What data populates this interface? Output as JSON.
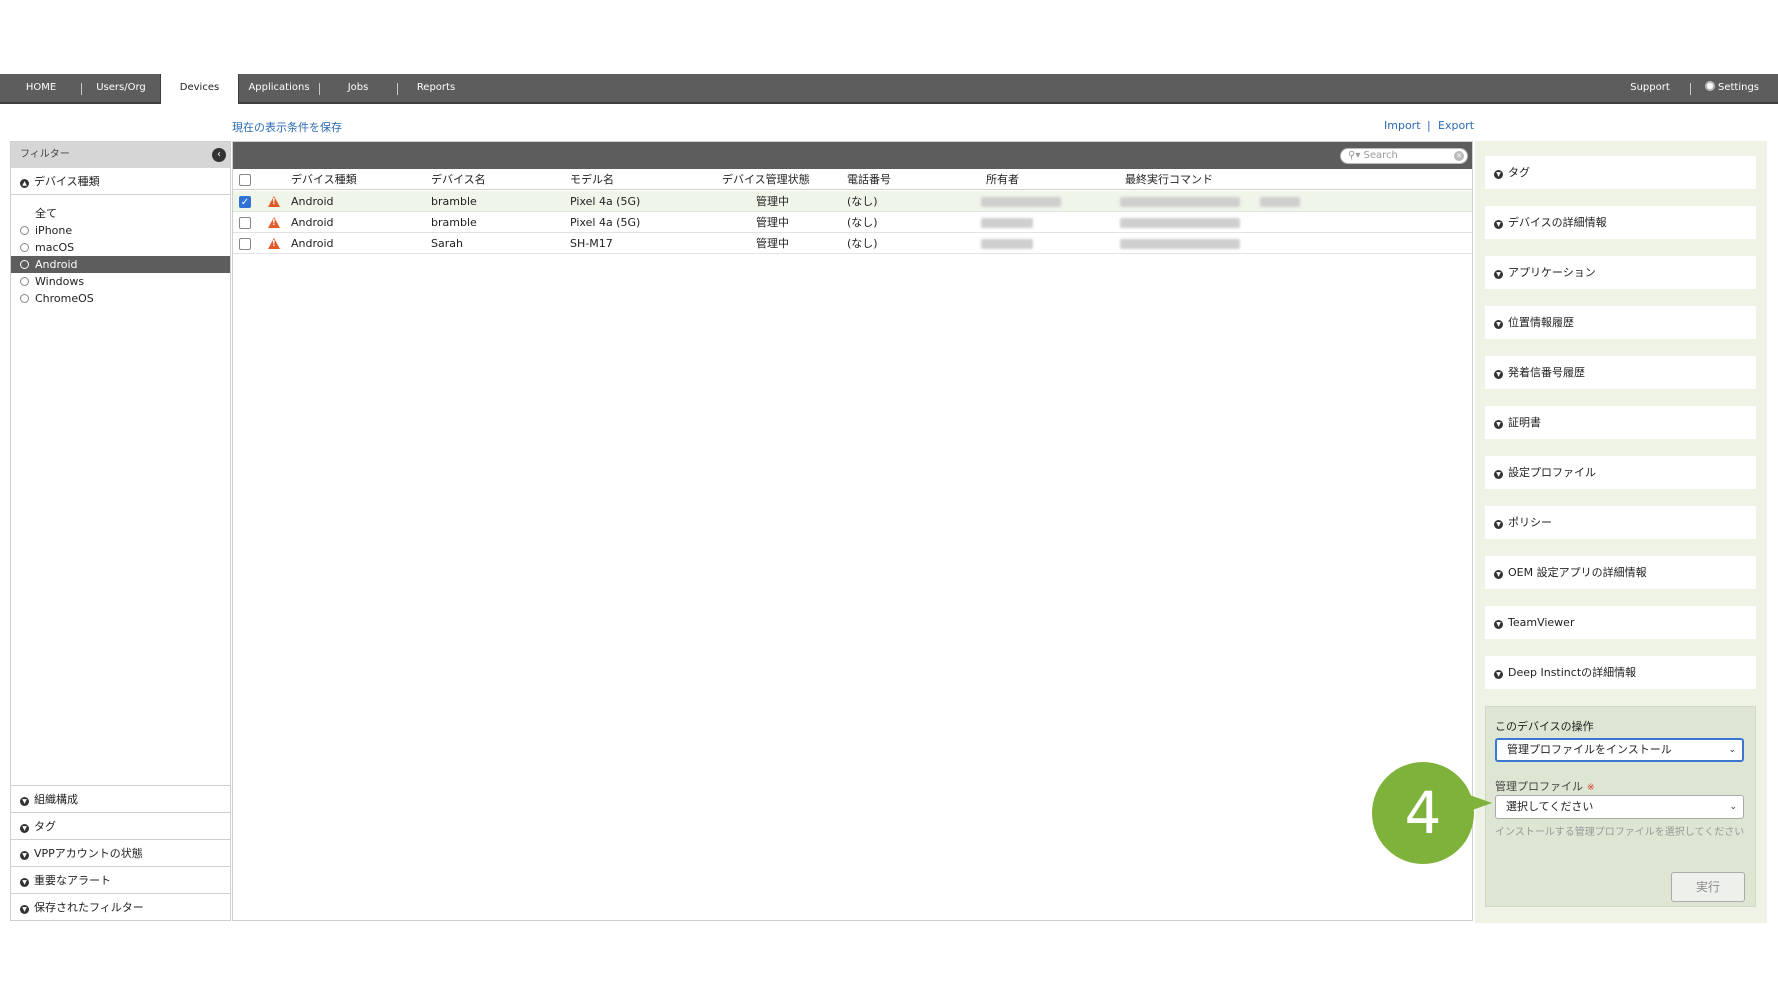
{
  "nav": {
    "tabs": [
      {
        "label": "HOME"
      },
      {
        "label": "Users/Org"
      },
      {
        "label": "Devices"
      },
      {
        "label": "Applications"
      },
      {
        "label": "Jobs"
      },
      {
        "label": "Reports"
      }
    ],
    "active_tab": "Devices",
    "support": "Support",
    "settings": "Settings"
  },
  "links": {
    "save_view": "現在の表示条件を保存",
    "import": "Import",
    "separator": "|",
    "export": "Export"
  },
  "filter": {
    "title": "フィルター",
    "device_type_header": "デバイス種類",
    "items": [
      {
        "label": "全て"
      },
      {
        "label": "iPhone"
      },
      {
        "label": "macOS"
      },
      {
        "label": "Android"
      },
      {
        "label": "Windows"
      },
      {
        "label": "ChromeOS"
      }
    ],
    "selected": "Android",
    "bottom_sections": [
      {
        "label": "組織構成"
      },
      {
        "label": "タグ"
      },
      {
        "label": "VPPアカウントの状態"
      },
      {
        "label": "重要なアラート"
      },
      {
        "label": "保存されたフィルター"
      }
    ]
  },
  "search": {
    "placeholder": "Search"
  },
  "table": {
    "columns": [
      "デバイス種類",
      "デバイス名",
      "モデル名",
      "デバイス管理状態",
      "電話番号",
      "所有者",
      "最終実行コマンド"
    ],
    "rows": [
      {
        "checked": true,
        "type": "Android",
        "name": "bramble",
        "model": "Pixel 4a (5G)",
        "status": "管理中",
        "phone": "(なし)"
      },
      {
        "checked": false,
        "type": "Android",
        "name": "bramble",
        "model": "Pixel 4a (5G)",
        "status": "管理中",
        "phone": "(なし)"
      },
      {
        "checked": false,
        "type": "Android",
        "name": "Sarah",
        "model": "SH-M17",
        "status": "管理中",
        "phone": "(なし)"
      }
    ]
  },
  "right_panel": {
    "sections": [
      {
        "label": "タグ"
      },
      {
        "label": "デバイスの詳細情報"
      },
      {
        "label": "アプリケーション"
      },
      {
        "label": "位置情報履歴"
      },
      {
        "label": "発着信番号履歴"
      },
      {
        "label": "証明書"
      },
      {
        "label": "設定プロファイル"
      },
      {
        "label": "ポリシー"
      },
      {
        "label": "OEM 設定アプリの詳細情報"
      },
      {
        "label": "TeamViewer"
      },
      {
        "label": "Deep Instinctの詳細情報"
      }
    ],
    "ops": {
      "title": "このデバイスの操作",
      "action_value": "管理プロファイルをインストール",
      "profile_label": "管理プロファイル",
      "required_mark": "※",
      "profile_value": "選択してください",
      "help": "インストールする管理プロファイルを選択してください",
      "run_label": "実行"
    }
  },
  "callout": {
    "number": "4"
  },
  "colors": {
    "nav_bg": "#5d5d5d",
    "link": "#2a6ab3",
    "right_panel_bg": "#eef3e6",
    "callout": "#7fb23a",
    "warning": "#e25a2a",
    "checkbox": "#2f73d8"
  }
}
